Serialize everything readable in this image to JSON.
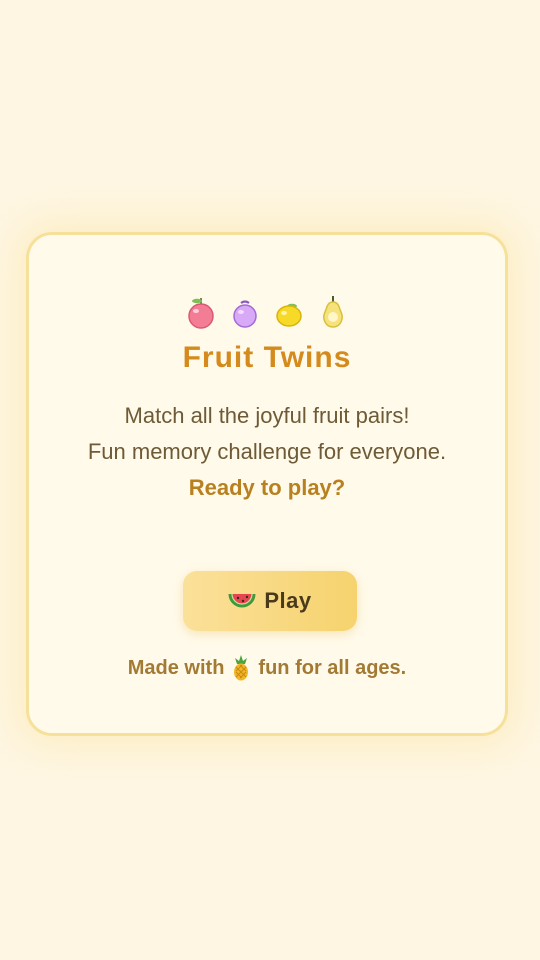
{
  "app": {
    "fruit_icons": [
      "peach-icon",
      "plum-icon",
      "lemon-icon",
      "pear-icon"
    ],
    "title": "Fruit Twins",
    "description_line1": "Match all the joyful fruit pairs!",
    "description_line2": "Fun memory challenge for everyone.",
    "ready_text": "Ready to play?",
    "play_button": {
      "icon": "watermelon-icon",
      "label": "Play"
    },
    "footer": {
      "before": "Made with",
      "icon": "pineapple-icon",
      "after": "fun for all ages."
    }
  },
  "colors": {
    "background": "#fef6e2",
    "card_background": "#fffaea",
    "card_border": "#f6e19b",
    "title": "#d48a1c",
    "body_text": "#6e5a36",
    "accent_text": "#b9801f",
    "button_gradient_start": "#fbe09a",
    "button_gradient_end": "#f6d36e"
  }
}
